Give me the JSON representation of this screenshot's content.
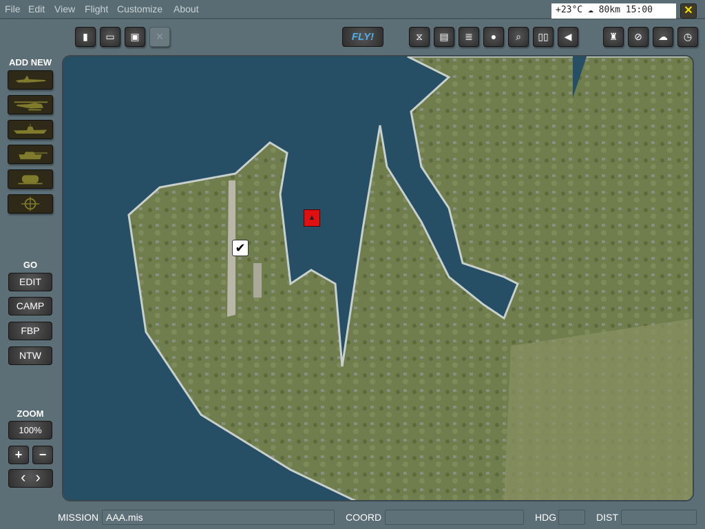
{
  "menu": [
    "File",
    "Edit",
    "View",
    "Flight",
    "Customize",
    "About"
  ],
  "status": {
    "temperature": "+23°C",
    "weather_icon": "cloud-icon",
    "visibility": "80km",
    "time": "15:00"
  },
  "close_label": "✕",
  "toolbar": {
    "left": [
      {
        "name": "new",
        "glyph": "▮"
      },
      {
        "name": "open",
        "glyph": "▭"
      },
      {
        "name": "save",
        "glyph": "▣"
      },
      {
        "name": "close-mission",
        "glyph": "✕"
      }
    ],
    "fly_label": "FLY!",
    "middle": [
      {
        "name": "briefing",
        "glyph": "⧖"
      },
      {
        "name": "clipboard",
        "glyph": "▤"
      },
      {
        "name": "notes",
        "glyph": "≣"
      },
      {
        "name": "pilot",
        "glyph": "●"
      },
      {
        "name": "search",
        "glyph": "⌕"
      },
      {
        "name": "book",
        "glyph": "▯▯"
      },
      {
        "name": "sound",
        "glyph": "◀"
      }
    ],
    "right": [
      {
        "name": "binoculars",
        "glyph": "♜"
      },
      {
        "name": "disable",
        "glyph": "⊘"
      },
      {
        "name": "weather",
        "glyph": "☁"
      },
      {
        "name": "clock",
        "glyph": "◷"
      }
    ]
  },
  "add_new": {
    "label": "ADD NEW",
    "items": [
      "airplane",
      "helicopter",
      "ship",
      "tank",
      "vehicle",
      "target"
    ]
  },
  "go": {
    "label": "GO",
    "items": [
      "EDIT",
      "CAMP",
      "FBP",
      "NTW"
    ]
  },
  "zoom": {
    "label": "ZOOM",
    "value": "100%",
    "plus": "+",
    "minus": "−",
    "prev": "‹",
    "next": "›"
  },
  "bottom": {
    "mission_label": "MISSION",
    "mission_value": "AAA.mis",
    "coord_label": "COORD",
    "coord_value": "",
    "hdg_label": "HDG",
    "hdg_value": "",
    "dist_label": "DIST",
    "dist_value": ""
  },
  "colors": {
    "water": "#264f66",
    "land": "#6f7c4b",
    "enemy": "#e01010"
  }
}
